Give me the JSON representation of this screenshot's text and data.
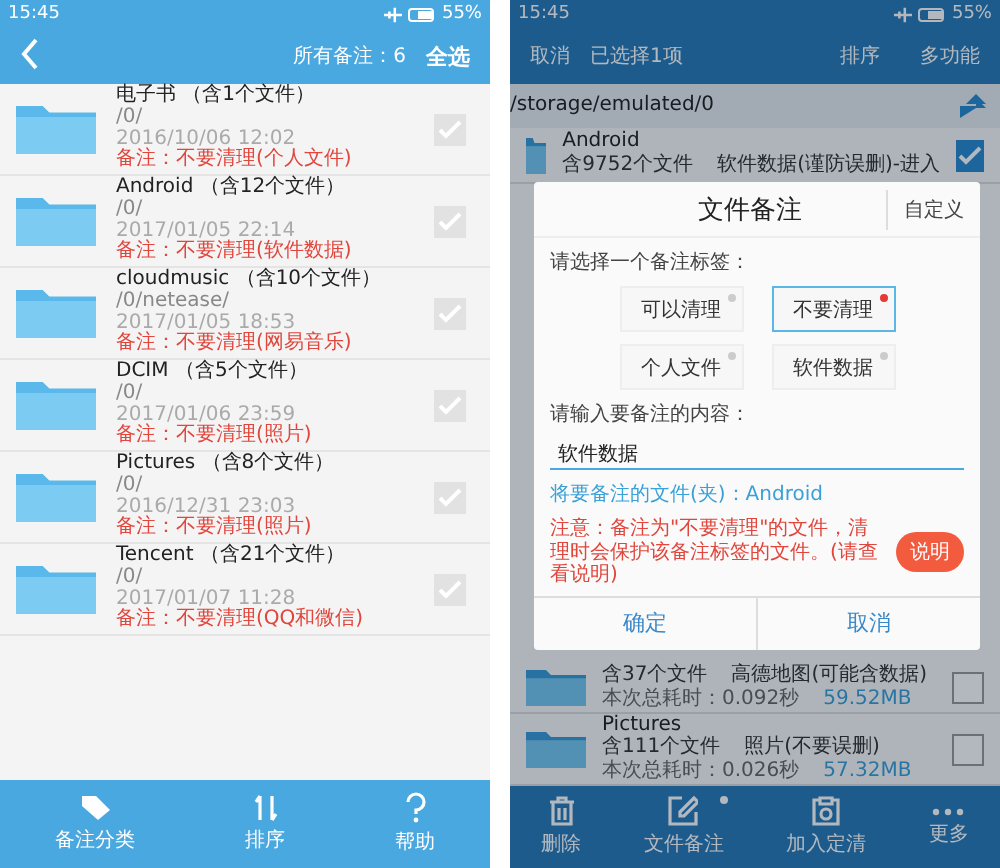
{
  "left": {
    "status_bar": {
      "time": "15:45",
      "battery": "55%"
    },
    "header": {
      "count_label": "所有备注：6",
      "select_all": "全选"
    },
    "folders": [
      {
        "name": "电子书 （含1个文件）",
        "path": "/0/",
        "date": "2016/10/06 12:02",
        "note": "备注：不要清理(个人文件)",
        "checked": true
      },
      {
        "name": "Android （含12个文件）",
        "path": "/0/",
        "date": "2017/01/05 22:14",
        "note": "备注：不要清理(软件数据)",
        "checked": true
      },
      {
        "name": "cloudmusic （含10个文件）",
        "path": "/0/netease/",
        "date": "2017/01/05 18:53",
        "note": "备注：不要清理(网易音乐)",
        "checked": true
      },
      {
        "name": "DCIM （含5个文件）",
        "path": "/0/",
        "date": "2017/01/06 23:59",
        "note": "备注：不要清理(照片)",
        "checked": true
      },
      {
        "name": "Pictures （含8个文件）",
        "path": "/0/",
        "date": "2016/12/31 23:03",
        "note": "备注：不要清理(照片)",
        "checked": true
      },
      {
        "name": "Tencent （含21个文件）",
        "path": "/0/",
        "date": "2017/01/07 11:28",
        "note": "备注：不要清理(QQ和微信)",
        "checked": true
      }
    ],
    "bottom_bar": [
      {
        "kind": "tag",
        "label": "备注分类"
      },
      {
        "kind": "sort",
        "label": "排序"
      },
      {
        "kind": "help",
        "label": "帮助"
      }
    ]
  },
  "right": {
    "status_bar": {
      "time": "15:45",
      "battery": "55%"
    },
    "header": {
      "cancel": "取消",
      "selected_count": "已选择1项",
      "sort": "排序",
      "more": "多功能"
    },
    "path": "/storage/emulated/0",
    "top_row": {
      "name": "Android",
      "count": "含9752个文件",
      "note": "软件数据(谨防误删)-进入",
      "checked": true
    },
    "bottom_rows": [
      {
        "count": "含37个文件",
        "note": "高德地图(可能含数据)",
        "time": "本次总耗时：0.092秒",
        "size": "59.52MB",
        "checked": false
      },
      {
        "name": "Pictures",
        "count": "含111个文件",
        "note": "照片(不要误删)",
        "time": "本次总耗时：0.026秒",
        "size": "57.32MB",
        "checked": false
      }
    ],
    "dialog": {
      "title": "文件备注",
      "custom": "自定义",
      "tag_prompt": "请选择一个备注标签：",
      "tags": [
        {
          "label": "可以清理",
          "selected": false
        },
        {
          "label": "不要清理",
          "selected": true
        },
        {
          "label": "个人文件",
          "selected": false
        },
        {
          "label": "软件数据",
          "selected": false
        }
      ],
      "input_prompt": "请输入要备注的内容：",
      "input_value": "软件数据",
      "target": "将要备注的文件(夹)：Android",
      "warning": "注意：备注为\"不要清理\"的文件，清理时会保护该备注标签的文件。(请查看说明)",
      "help": "说明",
      "confirm": "确定",
      "cancel": "取消"
    },
    "bottom_bar": [
      {
        "kind": "delete",
        "label": "删除",
        "dot": false
      },
      {
        "kind": "note",
        "label": "文件备注",
        "dot": true
      },
      {
        "kind": "clean",
        "label": "加入定清",
        "dot": false
      },
      {
        "kind": "more",
        "label": "更多",
        "dot": false
      }
    ]
  }
}
